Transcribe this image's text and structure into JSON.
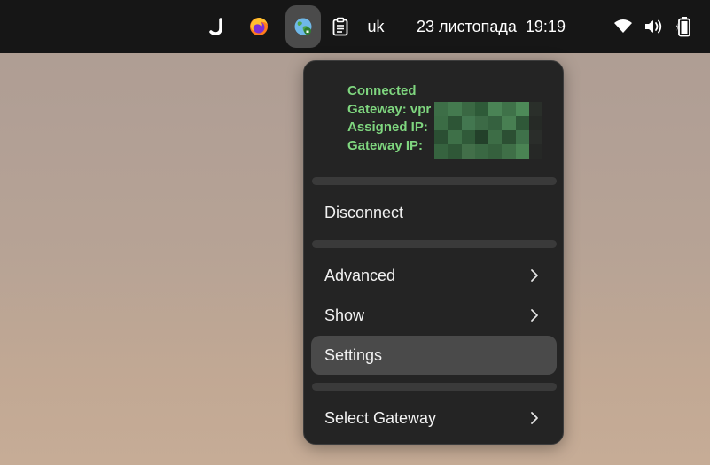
{
  "topbar": {
    "icons": [
      "jetbrains-toolbox-icon",
      "firefox-icon",
      "vpn-globe-icon",
      "clipboard-icon",
      "wifi-icon",
      "volume-icon",
      "battery-icon"
    ],
    "language": "uk",
    "date": "23 листопада",
    "time": "19:19"
  },
  "vpn_menu": {
    "status": {
      "connected": "Connected",
      "gateway_label": "Gateway: vpr",
      "assigned_ip_label": "Assigned IP:",
      "gateway_ip_label": "Gateway IP:"
    },
    "items": [
      {
        "label": "Disconnect",
        "submenu": false
      },
      {
        "label": "Advanced",
        "submenu": true
      },
      {
        "label": "Show",
        "submenu": true
      },
      {
        "label": "Settings",
        "submenu": false,
        "highlighted": true
      },
      {
        "label": "Select Gateway",
        "submenu": true
      }
    ]
  },
  "colors": {
    "panel": "#161616",
    "menu_background": "#242424",
    "status_text": "#7fd67f",
    "highlight": "#4a4a4a"
  }
}
